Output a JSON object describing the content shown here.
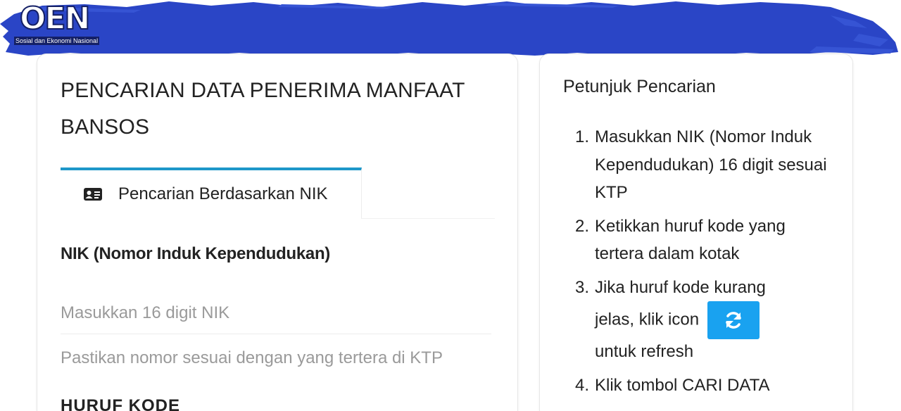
{
  "header": {
    "logo_mark": "OEN",
    "logo_subtitle": "Sosial dan Ekonomi Nasional",
    "banner_color": "#2a45c6"
  },
  "search_panel": {
    "title": "PENCARIAN DATA PENERIMA MANFAAT BANSOS",
    "tab": {
      "icon": "id-card-icon",
      "label": "Pencarian Berdasarkan NIK",
      "accent": "#1e97c9"
    },
    "nik_field": {
      "label": "NIK (Nomor Induk Kependudukan)",
      "value": "",
      "placeholder": "Masukkan 16 digit NIK",
      "help": "Pastikan nomor sesuai dengan yang tertera di KTP"
    },
    "captcha_label": "HURUF KODE"
  },
  "guide_panel": {
    "title": "Petunjuk Pencarian",
    "steps": [
      {
        "num": "1.",
        "text": "Masukkan NIK (Nomor Induk Kependudukan) 16 digit sesuai KTP"
      },
      {
        "num": "2.",
        "text": "Ketikkan huruf kode yang tertera dalam kotak"
      },
      {
        "num": "3.",
        "text_before": "Jika huruf kode kurang",
        "text_inline": "jelas, klik icon",
        "text_after": "untuk refresh",
        "button_icon": "refresh-icon",
        "button_color": "#19a2f0"
      },
      {
        "num": "4.",
        "text": "Klik tombol CARI DATA"
      }
    ]
  }
}
